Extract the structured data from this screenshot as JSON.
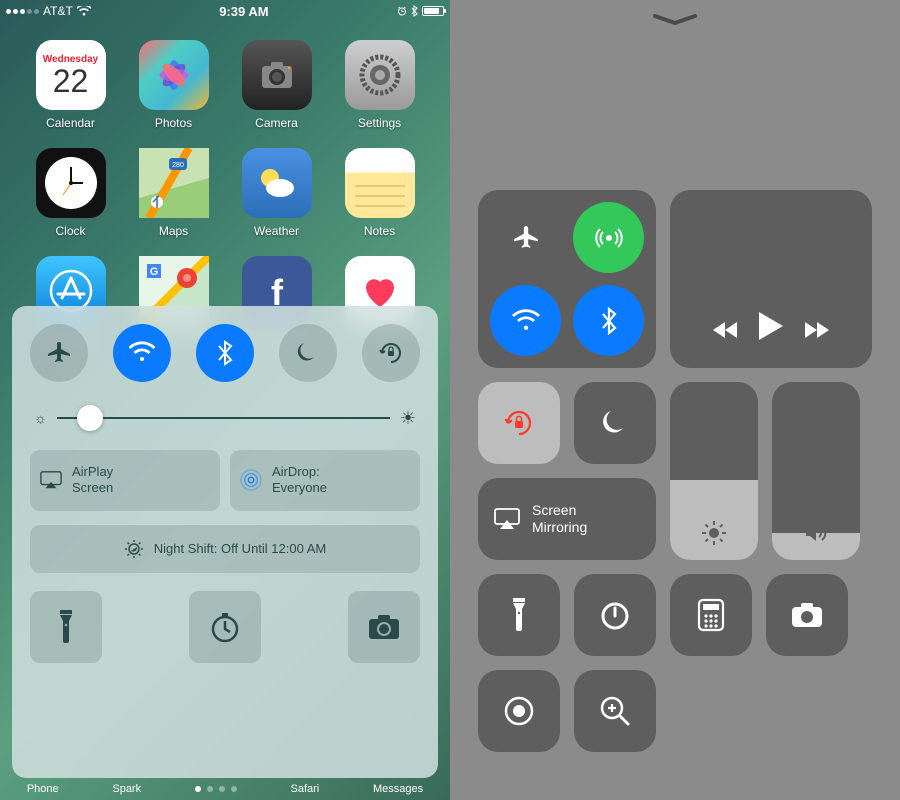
{
  "left": {
    "status": {
      "carrier": "AT&T",
      "time": "9:39 AM",
      "signal_filled": 3
    },
    "home_apps": [
      {
        "id": "calendar",
        "label": "Calendar",
        "weekday": "Wednesday",
        "day": "22"
      },
      {
        "id": "photos",
        "label": "Photos"
      },
      {
        "id": "camera",
        "label": "Camera"
      },
      {
        "id": "settings",
        "label": "Settings"
      },
      {
        "id": "clock",
        "label": "Clock"
      },
      {
        "id": "maps",
        "label": "Maps"
      },
      {
        "id": "weather",
        "label": "Weather"
      },
      {
        "id": "notes",
        "label": "Notes"
      },
      {
        "id": "app-store",
        "label": "App Store"
      },
      {
        "id": "google-maps",
        "label": "Google Maps"
      },
      {
        "id": "facebook",
        "label": "Facebook"
      },
      {
        "id": "health",
        "label": "Health"
      }
    ],
    "cc": {
      "toggles": [
        {
          "id": "airplane",
          "on": false
        },
        {
          "id": "wifi",
          "on": true
        },
        {
          "id": "bluetooth",
          "on": true
        },
        {
          "id": "dnd",
          "on": false
        },
        {
          "id": "rotation-lock",
          "on": false
        }
      ],
      "brightness_pct": 12,
      "airplay_label": "AirPlay\nScreen",
      "airdrop_label": "AirDrop:\nEveryone",
      "nightshift_label": "Night Shift: Off Until 12:00 AM",
      "shortcuts": [
        "flashlight",
        "timer",
        "camera"
      ]
    },
    "dock": [
      "Phone",
      "Spark",
      "Safari",
      "Messages"
    ]
  },
  "right": {
    "connectivity": [
      {
        "id": "airplane",
        "state": "off"
      },
      {
        "id": "cellular",
        "state": "green"
      },
      {
        "id": "wifi",
        "state": "blue"
      },
      {
        "id": "bluetooth",
        "state": "blue"
      }
    ],
    "media": {
      "playing": false
    },
    "rotation_lock_on": true,
    "dnd_on": false,
    "screen_mirroring_label": "Screen\nMirroring",
    "brightness_pct": 45,
    "volume_pct": 15,
    "shortcuts_row1": [
      "flashlight",
      "timer",
      "calculator",
      "camera"
    ],
    "shortcuts_row2": [
      "screen-record",
      "magnifier"
    ]
  }
}
